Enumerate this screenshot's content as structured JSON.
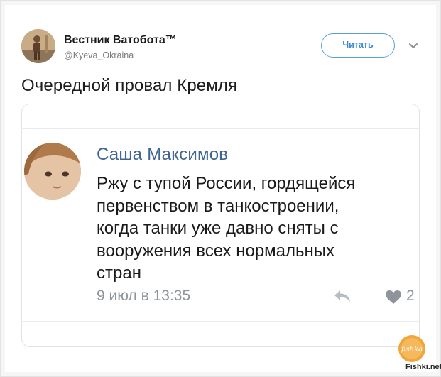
{
  "account": {
    "name": "Вестник Ватобота™",
    "handle": "@Kyeva_Okraina"
  },
  "follow_button": {
    "label": "Читать"
  },
  "tweet": {
    "text": "Очередной провал Кремля"
  },
  "embedded_post": {
    "author": "Саша Максимов",
    "lines": [
      "Ржу с тупой России, гордящейся",
      "первенством в танкостроении,",
      "когда танки уже давно сняты с",
      "вооружения всех нормальных",
      "стран"
    ],
    "date": "9 июл в 13:35",
    "likes": "2"
  },
  "watermark": {
    "logo_text": "fishka",
    "site": "Fishki.net"
  },
  "colors": {
    "accent": "#3f8ad0",
    "vk_name": "#3e6591",
    "meta": "#8e949a",
    "watermark": "#f0a63a"
  },
  "icons": [
    "chevron-down-icon",
    "share-icon",
    "heart-icon",
    "fishki-logo-icon"
  ]
}
